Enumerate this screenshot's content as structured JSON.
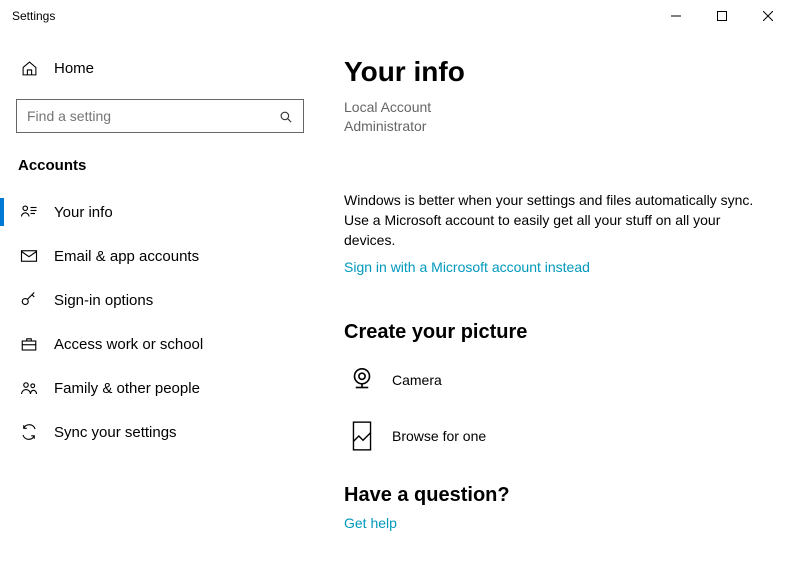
{
  "window": {
    "title": "Settings"
  },
  "sidebar": {
    "home_label": "Home",
    "search_placeholder": "Find a setting",
    "section_header": "Accounts",
    "items": [
      {
        "label": "Your info"
      },
      {
        "label": "Email & app accounts"
      },
      {
        "label": "Sign-in options"
      },
      {
        "label": "Access work or school"
      },
      {
        "label": "Family & other people"
      },
      {
        "label": "Sync your settings"
      }
    ]
  },
  "main": {
    "title": "Your info",
    "account_type_line1": "Local Account",
    "account_type_line2": "Administrator",
    "sync_text": "Windows is better when your settings and files automatically sync. Use a Microsoft account to easily get all your stuff on all your devices.",
    "signin_link": "Sign in with a Microsoft account instead",
    "picture_section_title": "Create your picture",
    "camera_label": "Camera",
    "browse_label": "Browse for one",
    "question_title": "Have a question?",
    "get_help_link": "Get help"
  }
}
